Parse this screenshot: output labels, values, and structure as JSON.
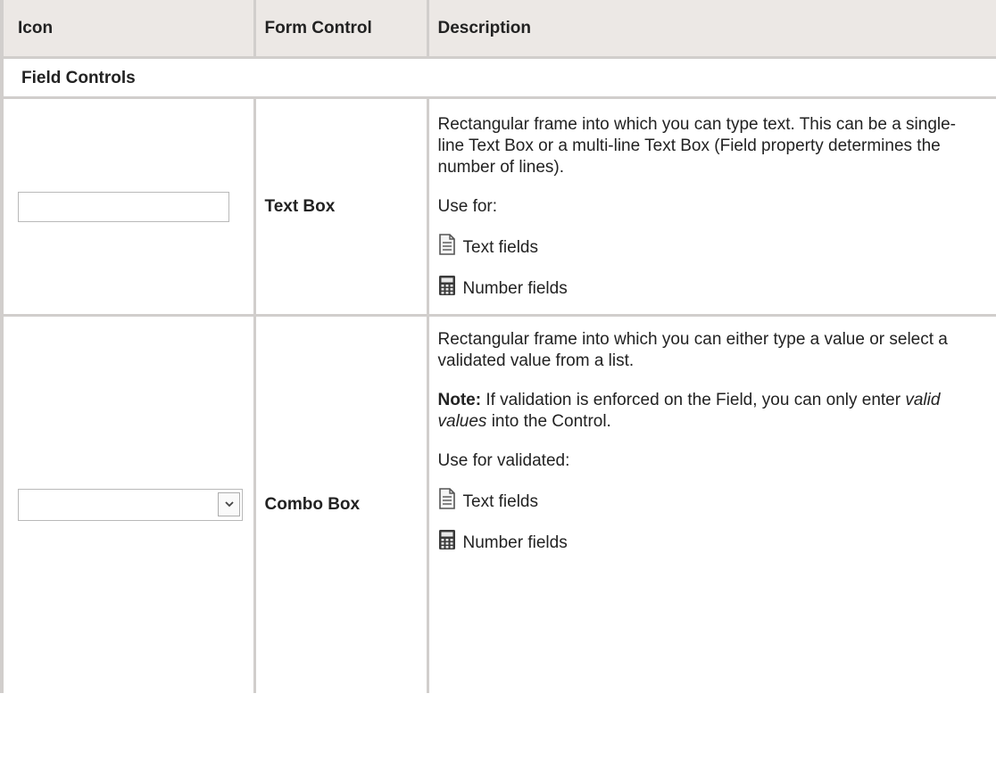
{
  "header": {
    "icon": "Icon",
    "form_control": "Form Control",
    "description": "Description"
  },
  "section_title": "Field Controls",
  "rows": [
    {
      "control_name": "Text Box",
      "icon_semantic": "textbox-icon",
      "description": "Rectangular frame into which you can type text. This can be a single-line Text Box or a multi-line Text Box (Field property determines the number of lines).",
      "use_for_label": "Use for:",
      "fields": [
        {
          "icon": "text-field-icon",
          "label": "Text fields"
        },
        {
          "icon": "calculator-icon",
          "label": "Number fields"
        }
      ]
    },
    {
      "control_name": "Combo Box",
      "icon_semantic": "combobox-icon",
      "description": "Rectangular frame into which you can either type a value or select a validated value from a list.",
      "note_label": "Note:",
      "note_text_before": " If validation is enforced on the Field, you can only enter ",
      "note_emphasis": "valid values",
      "note_text_after": " into the Control.",
      "use_for_label": "Use for validated:",
      "fields": [
        {
          "icon": "text-field-icon",
          "label": "Text fields"
        },
        {
          "icon": "calculator-icon",
          "label": "Number fields"
        }
      ]
    }
  ],
  "colors": {
    "header_bg": "#ece8e5",
    "border": "#d1cecc",
    "text": "#222222"
  }
}
